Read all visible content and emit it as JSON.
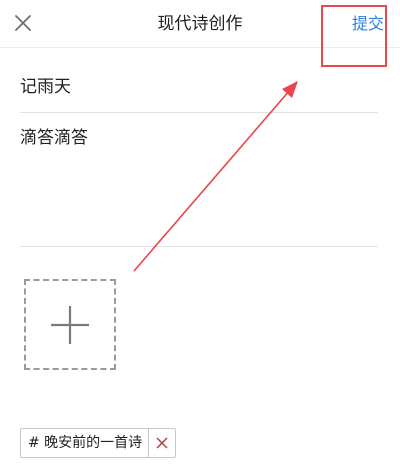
{
  "header": {
    "title": "现代诗创作",
    "submit_label": "提交",
    "close_icon": "close-icon"
  },
  "editor": {
    "title_value": "记雨天",
    "content_value": "滴答滴答",
    "add_image_icon": "plus-icon"
  },
  "tag": {
    "label": "# 晚安前的一首诗",
    "remove_icon": "close-icon"
  },
  "colors": {
    "accent": "#2e7fe0",
    "annotation": "#e8464d",
    "text": "#222222",
    "divider": "#e3e3e3"
  }
}
